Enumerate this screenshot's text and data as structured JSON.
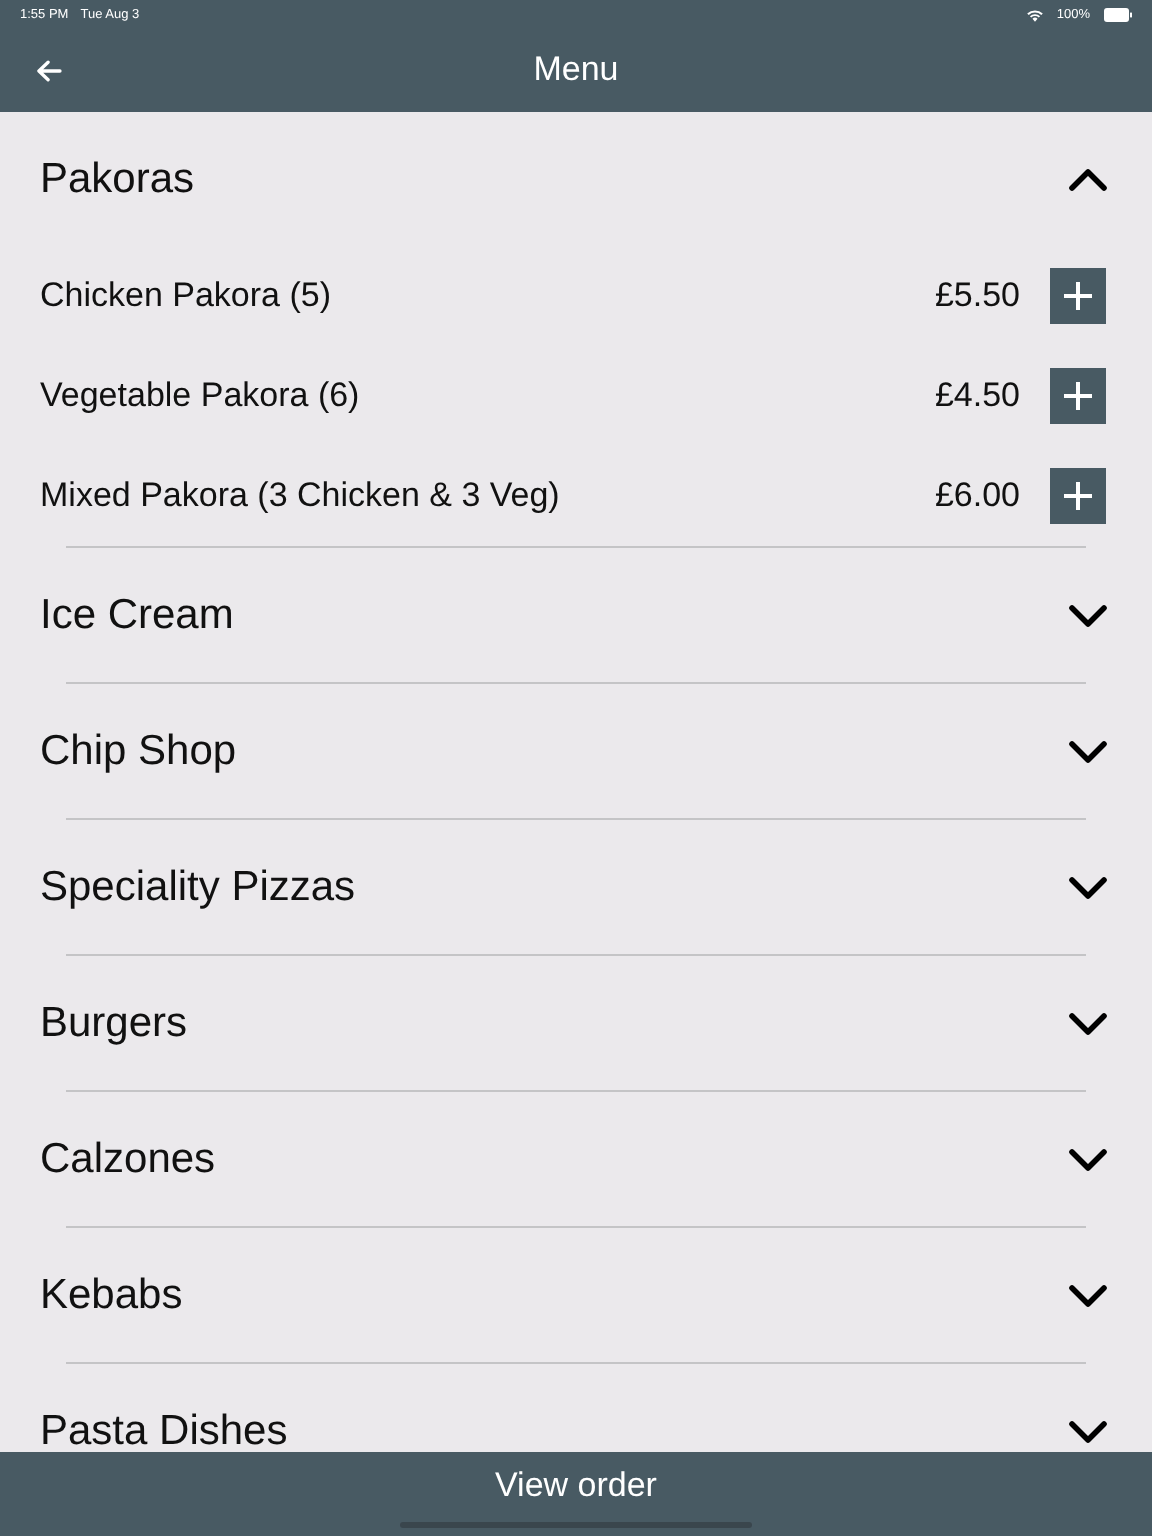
{
  "status_bar": {
    "time": "1:55 PM",
    "date": "Tue Aug 3",
    "battery": "100%"
  },
  "header": {
    "title": "Menu"
  },
  "categories": [
    {
      "name": "Pakoras",
      "expanded": true,
      "items": [
        {
          "name": "Chicken Pakora (5)",
          "price": "£5.50"
        },
        {
          "name": "Vegetable Pakora (6)",
          "price": "£4.50"
        },
        {
          "name": "Mixed Pakora (3 Chicken & 3 Veg)",
          "price": "£6.00"
        }
      ]
    },
    {
      "name": "Ice Cream",
      "expanded": false
    },
    {
      "name": "Chip Shop",
      "expanded": false
    },
    {
      "name": "Speciality Pizzas",
      "expanded": false
    },
    {
      "name": "Burgers",
      "expanded": false
    },
    {
      "name": "Calzones",
      "expanded": false
    },
    {
      "name": "Kebabs",
      "expanded": false
    },
    {
      "name": "Pasta Dishes",
      "expanded": false
    }
  ],
  "footer": {
    "button": "View order"
  }
}
